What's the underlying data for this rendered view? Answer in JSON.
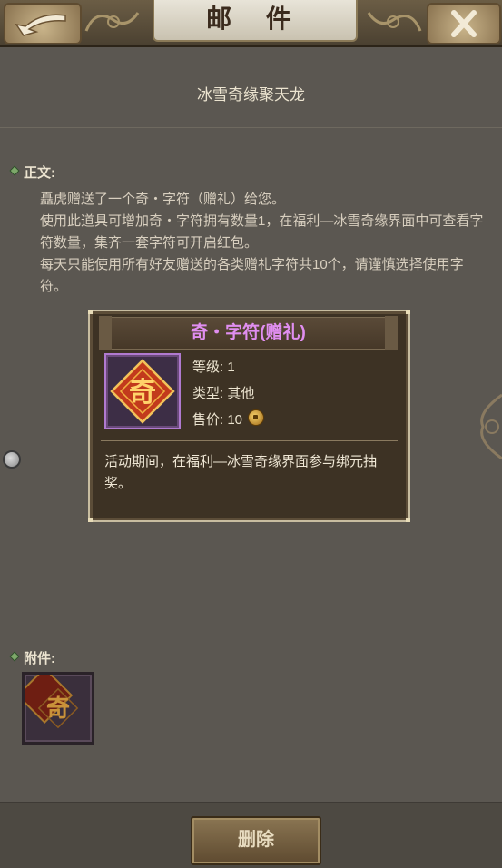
{
  "header": {
    "title": "邮 件",
    "back_icon": "back-arrow-icon",
    "close_icon": "close-icon"
  },
  "mail": {
    "subject": "冰雪奇缘聚天龙",
    "body_label": "正文:",
    "body_lines": [
      "矗虎赠送了一个奇・字符（赠礼）给您。",
      "使用此道具可增加奇・字符拥有数量1，在福利—冰雪奇缘界面中可查看字符数量，集齐一套字符可开启红包。",
      "每天只能使用所有好友赠送的各类赠礼字符共10个，请谨慎选择使用字符。"
    ],
    "attachment_label": "附件:",
    "attachment_glyph": "奇"
  },
  "tooltip": {
    "item_name": "奇・字符(赠礼)",
    "item_glyph": "奇",
    "level": "等级: 1",
    "type": "类型: 其他",
    "price_label": "售价: ",
    "price_value": "10",
    "description": "活动期间，在福利—冰雪奇缘界面参与绑元抽奖。",
    "name_color": "#e08ef0"
  },
  "footer": {
    "delete_label": "删除"
  }
}
